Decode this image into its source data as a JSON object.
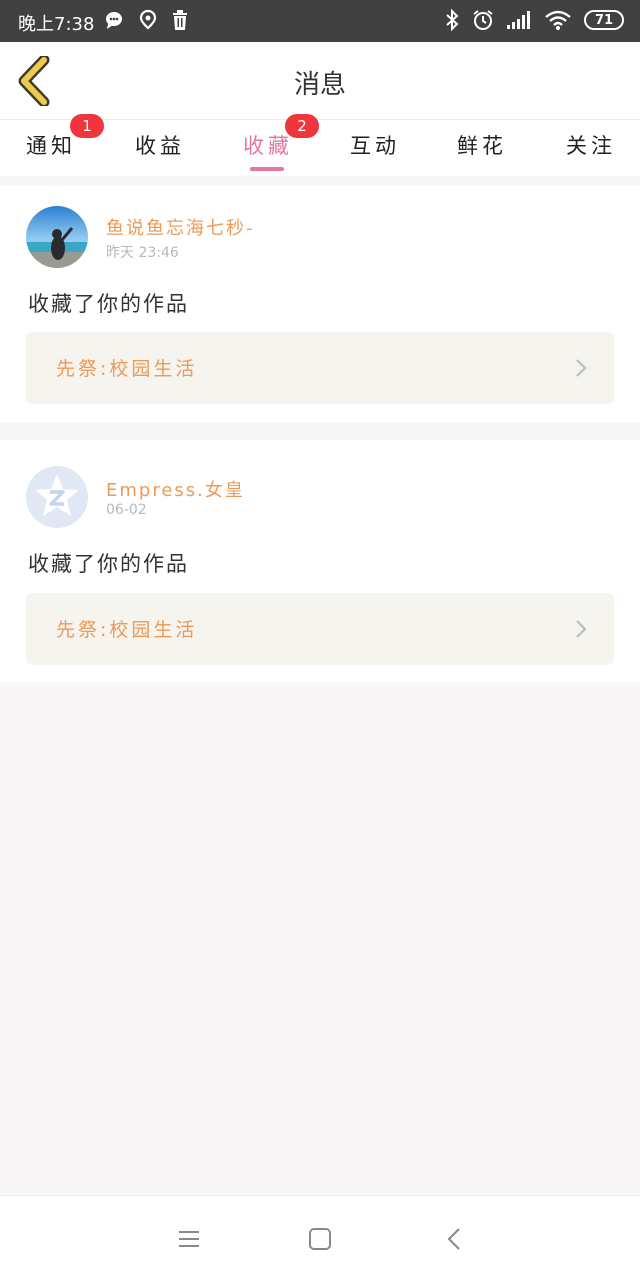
{
  "status_bar": {
    "time": "晚上7:38",
    "battery": "71",
    "left_icons": [
      "chat-bubble-icon",
      "location-icon",
      "trash-icon"
    ],
    "right_icons": [
      "bluetooth-icon",
      "alarm-icon",
      "signal-icon",
      "wifi-icon",
      "battery-icon"
    ]
  },
  "header": {
    "title": "消息"
  },
  "tabs": [
    {
      "label": "通知",
      "badge": "1",
      "active": false
    },
    {
      "label": "收益",
      "badge": "",
      "active": false
    },
    {
      "label": "收藏",
      "badge": "2",
      "active": true
    },
    {
      "label": "互动",
      "badge": "",
      "active": false
    },
    {
      "label": "鲜花",
      "badge": "",
      "active": false
    },
    {
      "label": "关注",
      "badge": "",
      "active": false
    }
  ],
  "messages": [
    {
      "username": "鱼说鱼忘海七秒-",
      "time": "昨天 23:46",
      "action": "收藏了你的作品",
      "work_title": "先祭:校园生活"
    },
    {
      "username": "Empress.女皇",
      "time": "06-02",
      "action": "收藏了你的作品",
      "work_title": "先祭:校园生活"
    }
  ],
  "colors": {
    "accent_pink": "#e575a6",
    "username_orange": "#ee9a57",
    "badge_red": "#f0353c",
    "back_arrow_yellow": "#f1c94b"
  }
}
